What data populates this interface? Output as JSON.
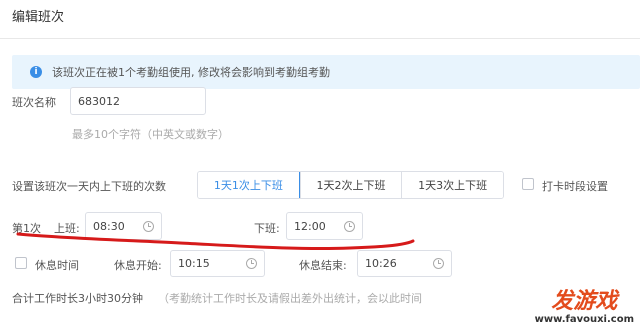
{
  "header": {
    "title": "编辑班次"
  },
  "notice": {
    "icon_char": "i",
    "text": "该班次正在被1个考勤组使用, 修改将会影响到考勤组考勤"
  },
  "shift_name": {
    "label": "班次名称",
    "value": "683012",
    "hint": "最多10个字符（中英文或数字）"
  },
  "frequency": {
    "label": "设置该班次一天内上下班的次数",
    "options": [
      "1天1次上下班",
      "1天2次上下班",
      "1天3次上下班"
    ],
    "selected_index": 0,
    "punch_period_label": "打卡时段设置",
    "punch_period_checked": false
  },
  "shift1": {
    "index_label": "第1次",
    "on_label": "上班:",
    "on_time": "08:30",
    "off_label": "下班:",
    "off_time": "12:00"
  },
  "rest": {
    "checkbox_label": "休息时间",
    "checked": false,
    "start_label": "休息开始:",
    "start_time": "10:15",
    "end_label": "休息结束:",
    "end_time": "10:26"
  },
  "total": {
    "text": "合计工作时长3小时30分钟",
    "note": "（考勤统计工作时长及请假出差外出统计，会以此时间"
  },
  "annotation": {
    "color": "#d61a1a"
  },
  "watermark": {
    "main": "发游戏",
    "url": "www.favouxi.com",
    "color": "#e34b1c"
  }
}
